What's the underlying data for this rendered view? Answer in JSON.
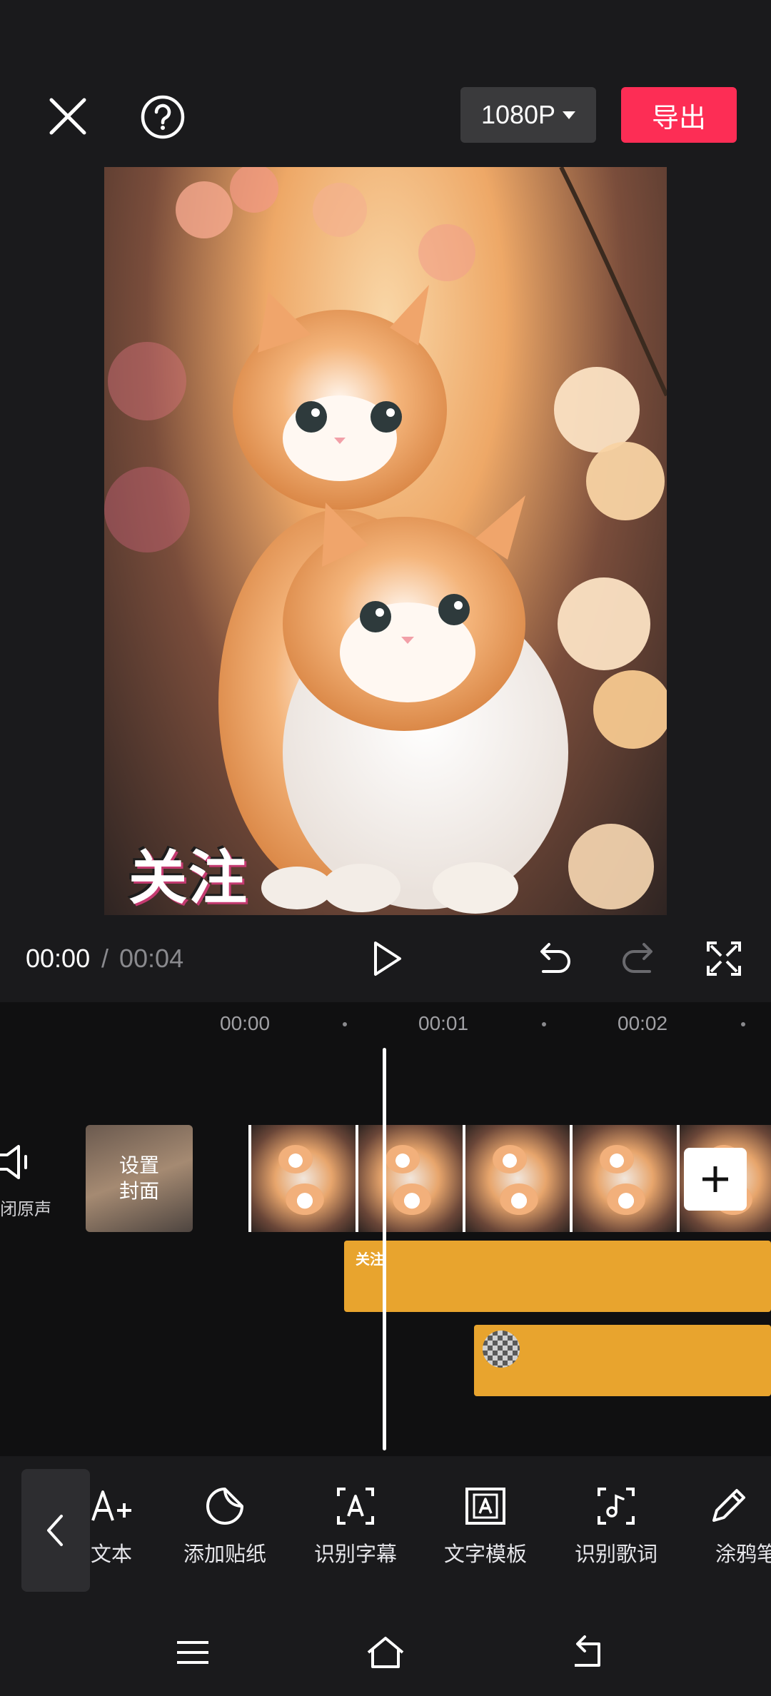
{
  "topbar": {
    "resolution": "1080P",
    "export_label": "导出"
  },
  "preview": {
    "sticker_text": "关注"
  },
  "player": {
    "current_time": "00:00",
    "separator": "/",
    "total_time": "00:04"
  },
  "timeline": {
    "ruler": [
      "00:00",
      "00:01",
      "00:02"
    ],
    "original_sound_label": "闭原声",
    "cover_label_line1": "设置",
    "cover_label_line2": "封面",
    "text_track_label": "关注"
  },
  "toolbar": {
    "items": [
      {
        "label": "文本",
        "icon": "add-text-icon"
      },
      {
        "label": "添加贴纸",
        "icon": "sticker-icon"
      },
      {
        "label": "识别字幕",
        "icon": "subtitle-recognize-icon"
      },
      {
        "label": "文字模板",
        "icon": "text-template-icon"
      },
      {
        "label": "识别歌词",
        "icon": "lyrics-recognize-icon"
      },
      {
        "label": "涂鸦笔",
        "icon": "brush-icon"
      }
    ]
  },
  "colors": {
    "accent": "#fd2d55",
    "track": "#e8a42e",
    "background": "#1a1a1c"
  }
}
